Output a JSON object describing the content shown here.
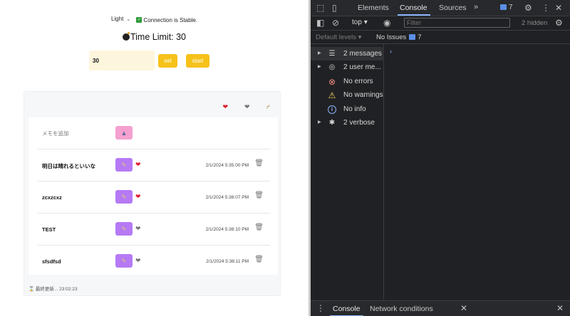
{
  "app": {
    "theme": "Light",
    "connection_status": "Connection is Stable.",
    "time_limit_label": "Time Limit: 30",
    "time_input_value": "30",
    "set_label": "set",
    "start_label": "start",
    "memo_add_label": "メモを追加",
    "memos": [
      {
        "text": "明日は晴れるといいな",
        "date": "2/1/2024 5:35:00 PM",
        "favorite": true
      },
      {
        "text": "zcxzcxz",
        "date": "2/1/2024 5:38:07 PM",
        "favorite": true
      },
      {
        "text": "TEST",
        "date": "2/1/2024 5:38:10 PM",
        "favorite": false
      },
      {
        "text": "sfsdfsd",
        "date": "2/1/2024 5:38:11 PM",
        "favorite": false
      }
    ],
    "footer": "最終更新... 23:02:23"
  },
  "devtools": {
    "tabs": [
      "Elements",
      "Console",
      "Sources"
    ],
    "active_tab": "Console",
    "issues_count": "7",
    "context": "top",
    "filter_placeholder": "Filter",
    "hidden_count": "2 hidden",
    "levels_label": "Default levels",
    "no_issues": "No Issues",
    "sidebar": [
      {
        "label": "2 messages",
        "icon": "list-icon"
      },
      {
        "label": "2 user me...",
        "icon": "user-icon"
      },
      {
        "label": "No errors",
        "icon": "error-icon"
      },
      {
        "label": "No warnings",
        "icon": "warning-icon"
      },
      {
        "label": "No info",
        "icon": "info-icon"
      },
      {
        "label": "2 verbose",
        "icon": "bug-icon"
      }
    ],
    "drawer_tabs": [
      "Console",
      "Network conditions"
    ]
  },
  "colors": {
    "accent_yellow": "#f6c21a",
    "edit_purple": "#b67af5",
    "add_pink": "#f5a0cf",
    "devtools_bg": "#202124",
    "devtools_accent": "#8ab4f8"
  }
}
